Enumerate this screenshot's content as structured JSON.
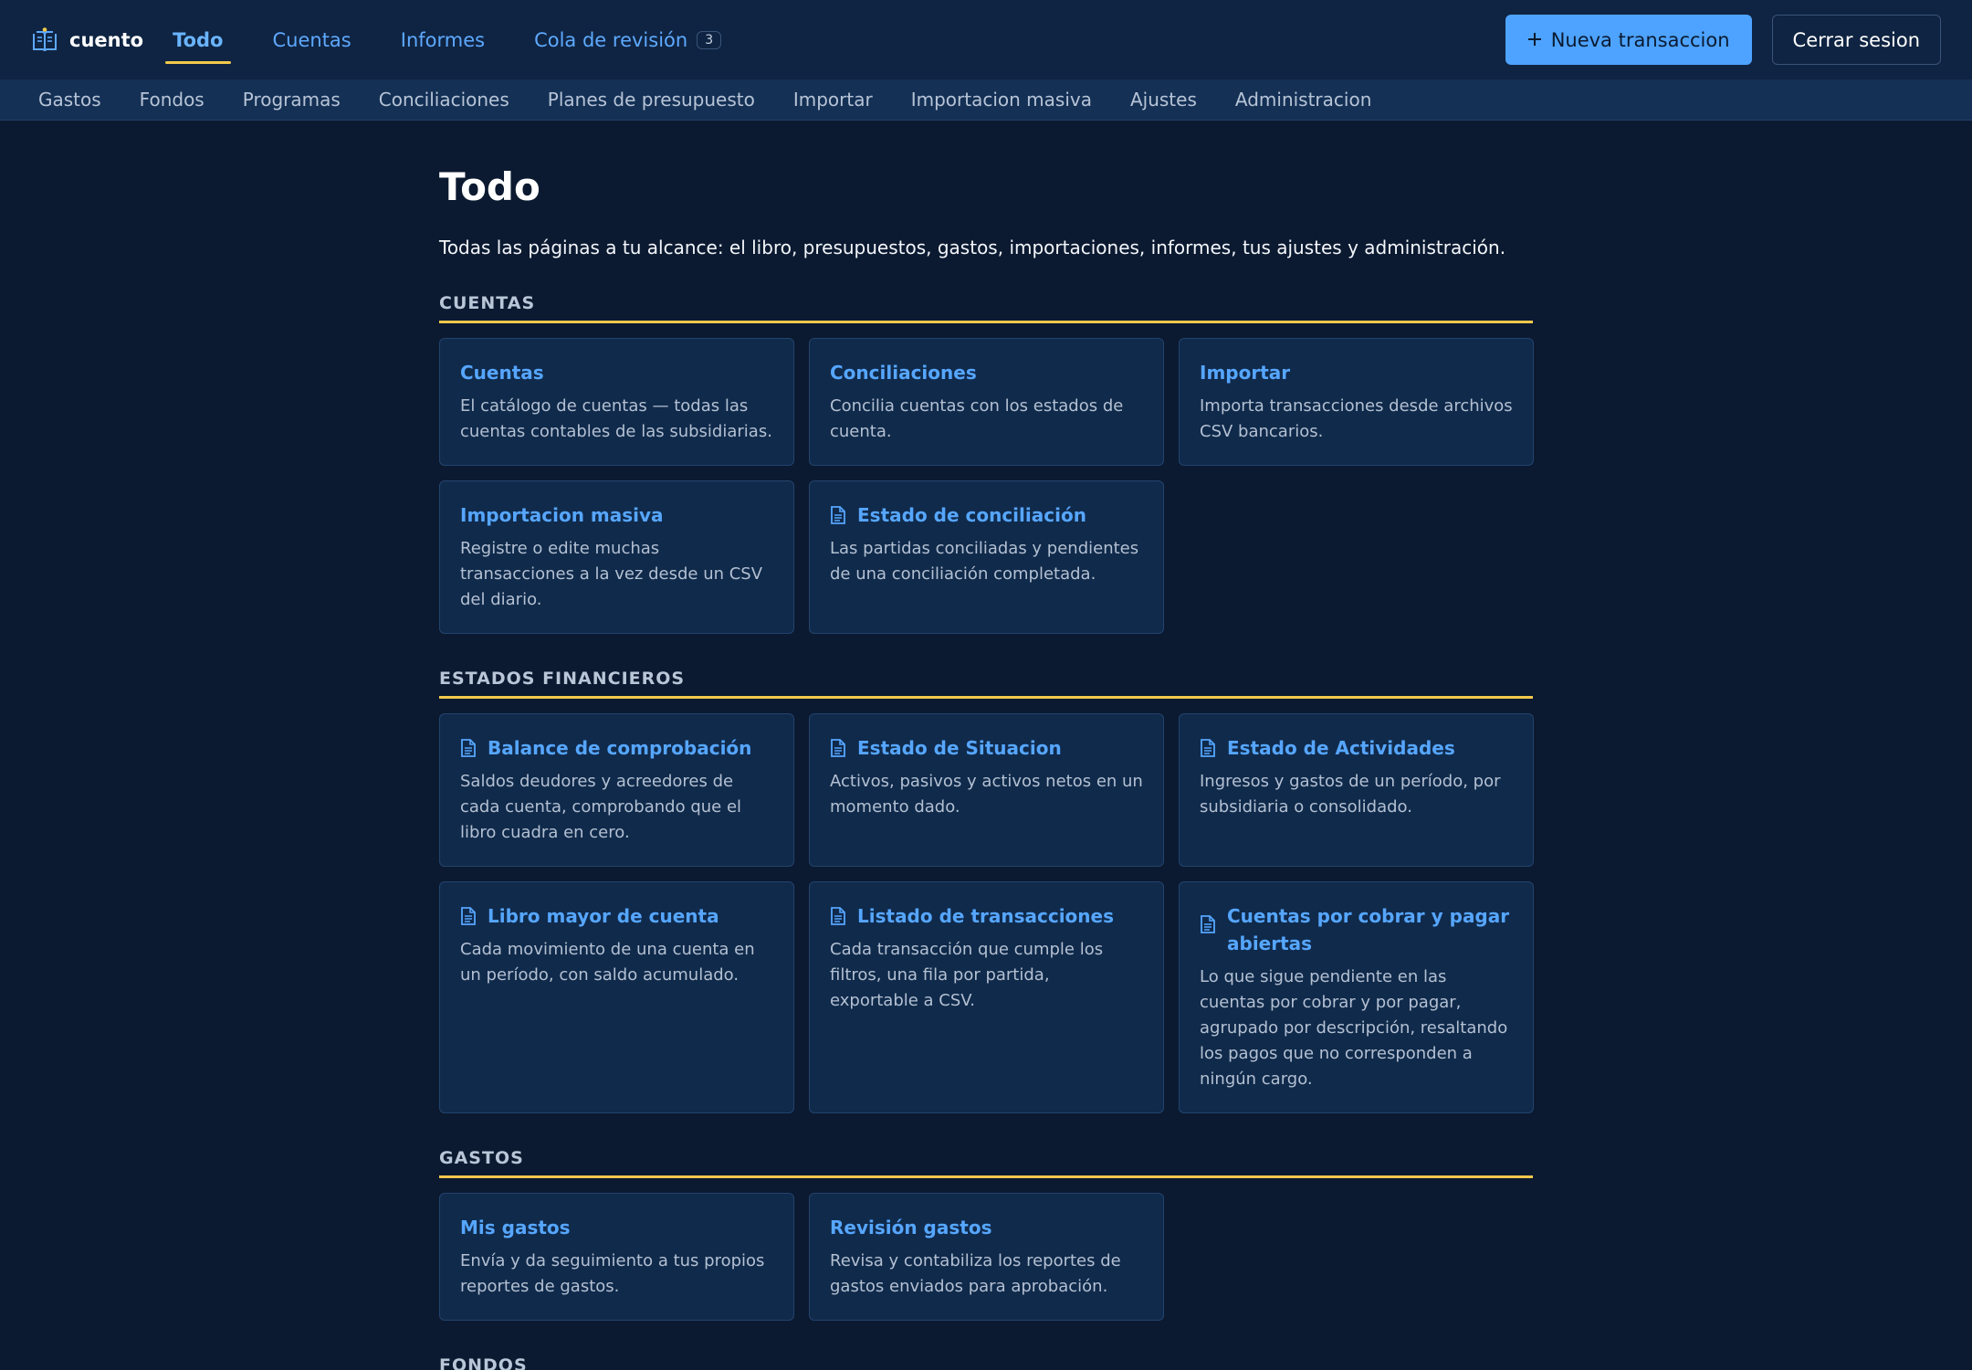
{
  "brand": {
    "name": "cuento",
    "icon": "book-icon"
  },
  "topnav": {
    "items": [
      {
        "label": "Todo",
        "active": true
      },
      {
        "label": "Cuentas"
      },
      {
        "label": "Informes"
      },
      {
        "label": "Cola de revisión",
        "badge": "3"
      }
    ]
  },
  "actions": {
    "new_transaction": "Nueva transaccion",
    "logout": "Cerrar sesion"
  },
  "subnav": [
    "Gastos",
    "Fondos",
    "Programas",
    "Conciliaciones",
    "Planes de presupuesto",
    "Importar",
    "Importacion masiva",
    "Ajustes",
    "Administracion"
  ],
  "page": {
    "title": "Todo",
    "description": "Todas las páginas a tu alcance: el libro, presupuestos, gastos, importaciones, informes, tus ajustes y administración."
  },
  "sections": [
    {
      "title": "CUENTAS",
      "cards": [
        {
          "title": "Cuentas",
          "desc": "El catálogo de cuentas — todas las cuentas contables de las subsidiarias.",
          "icon": ""
        },
        {
          "title": "Conciliaciones",
          "desc": "Concilia cuentas con los estados de cuenta.",
          "icon": ""
        },
        {
          "title": "Importar",
          "desc": "Importa transacciones desde archivos CSV bancarios.",
          "icon": ""
        },
        {
          "title": "Importacion masiva",
          "desc": "Registre o edite muchas transacciones a la vez desde un CSV del diario.",
          "icon": ""
        },
        {
          "title": "Estado de conciliación",
          "desc": "Las partidas conciliadas y pendientes de una conciliación completada.",
          "icon": "document-icon"
        }
      ]
    },
    {
      "title": "ESTADOS FINANCIEROS",
      "cards": [
        {
          "title": "Balance de comprobación",
          "desc": "Saldos deudores y acreedores de cada cuenta, comprobando que el libro cuadra en cero.",
          "icon": "document-icon"
        },
        {
          "title": "Estado de Situacion",
          "desc": "Activos, pasivos y activos netos en un momento dado.",
          "icon": "document-icon"
        },
        {
          "title": "Estado de Actividades",
          "desc": "Ingresos y gastos de un período, por subsidiaria o consolidado.",
          "icon": "document-icon"
        },
        {
          "title": "Libro mayor de cuenta",
          "desc": "Cada movimiento de una cuenta en un período, con saldo acumulado.",
          "icon": "document-icon"
        },
        {
          "title": "Listado de transacciones",
          "desc": "Cada transacción que cumple los filtros, una fila por partida, exportable a CSV.",
          "icon": "document-icon"
        },
        {
          "title": "Cuentas por cobrar y pagar abiertas",
          "desc": "Lo que sigue pendiente en las cuentas por cobrar y por pagar, agrupado por descripción, resaltando los pagos que no corresponden a ningún cargo.",
          "icon": "document-icon"
        }
      ]
    },
    {
      "title": "GASTOS",
      "cards": [
        {
          "title": "Mis gastos",
          "desc": "Envía y da seguimiento a tus propios reportes de gastos.",
          "icon": ""
        },
        {
          "title": "Revisión gastos",
          "desc": "Revisa y contabiliza los reportes de gastos enviados para aprobación.",
          "icon": ""
        }
      ]
    },
    {
      "title": "FONDOS",
      "cards": []
    }
  ],
  "colors": {
    "accent": "#4da3ff",
    "underline": "#f2c94c",
    "background": "#0b1a30",
    "card": "#102a4b"
  }
}
